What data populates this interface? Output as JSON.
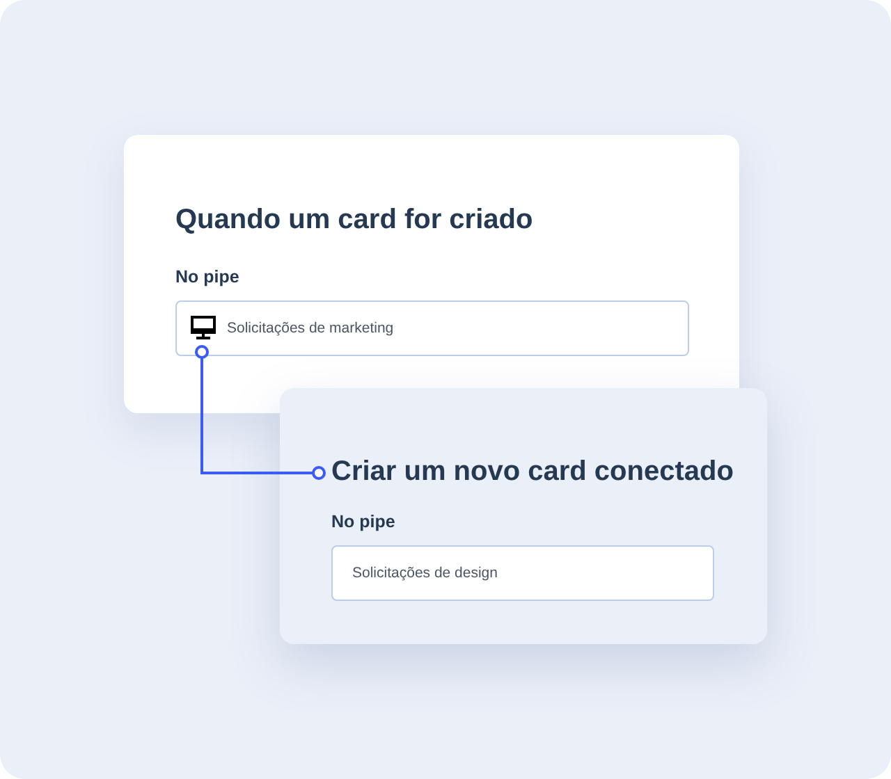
{
  "cards": [
    {
      "kind": "trigger",
      "title": "Quando um card for criado",
      "label": "No pipe",
      "value": "Solicitações de marketing"
    },
    {
      "kind": "action",
      "title": "Criar um novo card conectado",
      "label": "No pipe",
      "value": "Solicitações de design"
    }
  ]
}
